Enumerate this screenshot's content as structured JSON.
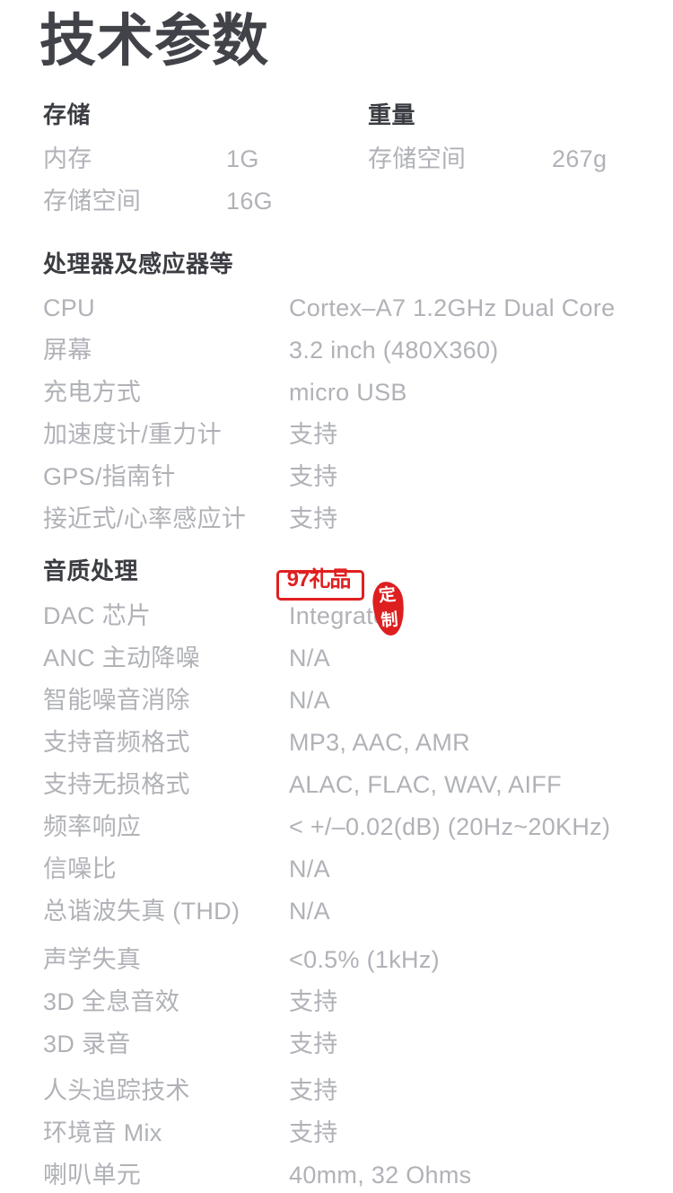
{
  "page": {
    "title": "技术参数",
    "text_color": "#b0b2b7",
    "heading_color": "#3b3d42",
    "title_color": "#414349",
    "background": "#ffffff"
  },
  "sections": [
    {
      "id": "storage",
      "heading": "存储",
      "rows": [
        {
          "label": "内存",
          "value": "1G"
        },
        {
          "label": "存储空间",
          "value": "16G"
        }
      ]
    },
    {
      "id": "weight",
      "heading": "重量",
      "rows": [
        {
          "label": "存储空间",
          "value": "267g"
        }
      ]
    },
    {
      "id": "processor",
      "heading": "处理器及感应器等",
      "rows": [
        {
          "label": "CPU",
          "value": "Cortex–A7 1.2GHz Dual Core"
        },
        {
          "label": "屏幕",
          "value": "3.2 inch (480X360)"
        },
        {
          "label": "充电方式",
          "value": "micro USB"
        },
        {
          "label": "加速度计/重力计",
          "value": "支持"
        },
        {
          "label": "GPS/指南针",
          "value": "支持"
        },
        {
          "label": "接近式/心率感应计",
          "value": "支持"
        }
      ]
    },
    {
      "id": "audio",
      "heading": "音质处理",
      "rows": [
        {
          "label": "DAC 芯片",
          "value": "Integrated"
        },
        {
          "label": "ANC 主动降噪",
          "value": "N/A"
        },
        {
          "label": "智能噪音消除",
          "value": "N/A"
        },
        {
          "label": "支持音频格式",
          "value": "MP3, AAC, AMR"
        },
        {
          "label": "支持无损格式",
          "value": "ALAC, FLAC, WAV, AIFF"
        },
        {
          "label": "频率响应",
          "value": "< +/–0.02(dB) (20Hz~20KHz)"
        },
        {
          "label": "信噪比",
          "value": "N/A"
        },
        {
          "label": "总谐波失真 (THD)",
          "value": "N/A"
        },
        {
          "label": "声学失真",
          "value": "<0.5% (1kHz)"
        },
        {
          "label": "3D 全息音效",
          "value": "支持"
        },
        {
          "label": "3D 录音",
          "value": "支持"
        },
        {
          "label": "人头追踪技术",
          "value": "支持"
        },
        {
          "label": "环境音 Mix",
          "value": "支持"
        },
        {
          "label": "喇叭单元",
          "value": "40mm, 32 Ohms"
        }
      ]
    }
  ],
  "watermark": {
    "box_text": "97礼品",
    "seal_text": "定制",
    "color": "#e02020"
  }
}
